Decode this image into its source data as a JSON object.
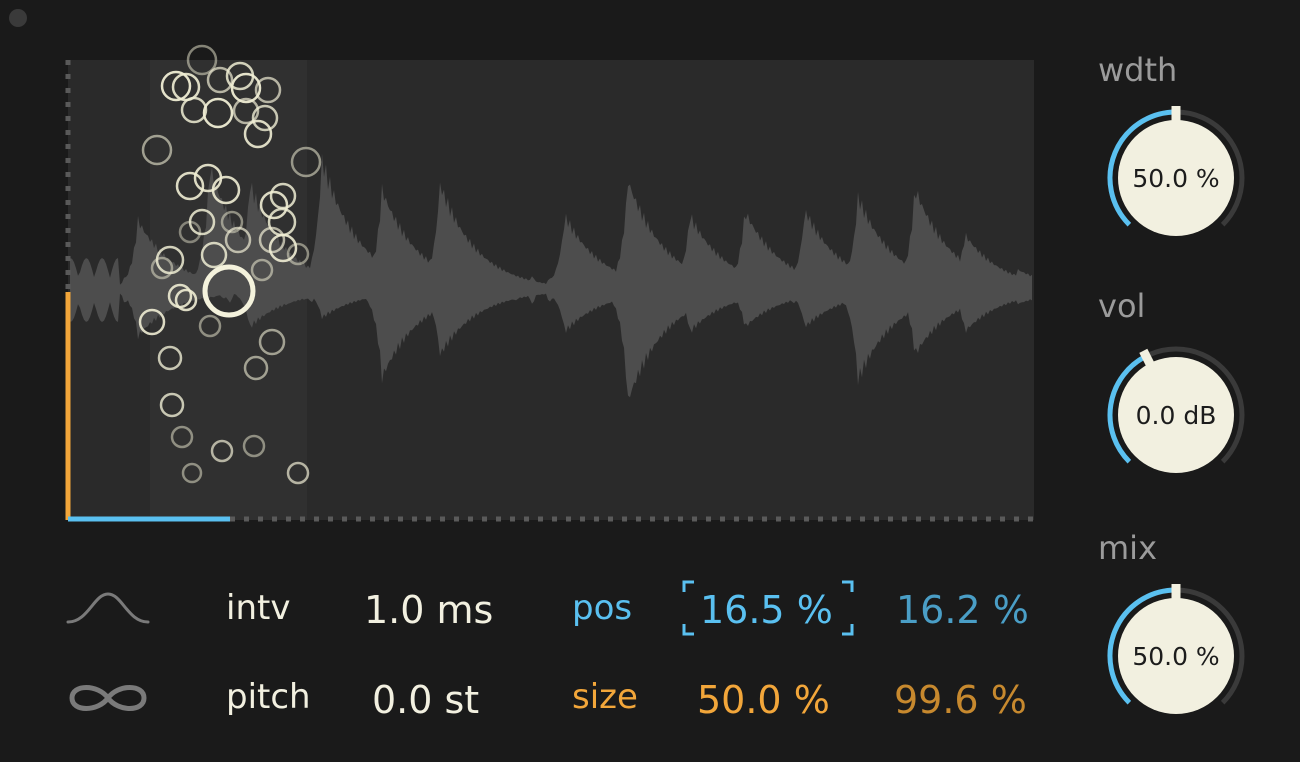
{
  "waveform": {
    "colors": {
      "panel": "#2a2a2a",
      "wave": "#4d4d4d",
      "selection": "#303030",
      "axis": "#5a5a5a",
      "grain": "#efedd4",
      "position": "#5ac0f0",
      "size": "#f2a63a"
    },
    "position_percent": 16.5,
    "size_percent": 50.0
  },
  "controls": {
    "envelope_icon": "bell-curve-icon",
    "loop_icon": "infinity-icon",
    "intv": {
      "label": "intv",
      "value": "1.0 ms"
    },
    "pitch": {
      "label": "pitch",
      "value": "0.0 st"
    },
    "pos": {
      "label": "pos",
      "value": "16.5 %",
      "spread": "16.2 %"
    },
    "size": {
      "label": "size",
      "value": "50.0 %",
      "spread": "99.6 %"
    }
  },
  "knobs": {
    "wdth": {
      "label": "wdth",
      "value": "50.0 %",
      "level": 0.5
    },
    "vol": {
      "label": "vol",
      "value": "0.0 dB",
      "level": 0.4
    },
    "mix": {
      "label": "mix",
      "value": "50.0 %",
      "level": 0.5
    }
  },
  "colors": {
    "label_blue": "#5ac0f0",
    "label_orange": "#f2a63a",
    "spread_blue": "#4a9ec6",
    "spread_orange": "#c7892e",
    "knob_face": "#f2f0e0",
    "knob_arc": "#5ac0f0",
    "knob_track": "#3a3a3a"
  }
}
